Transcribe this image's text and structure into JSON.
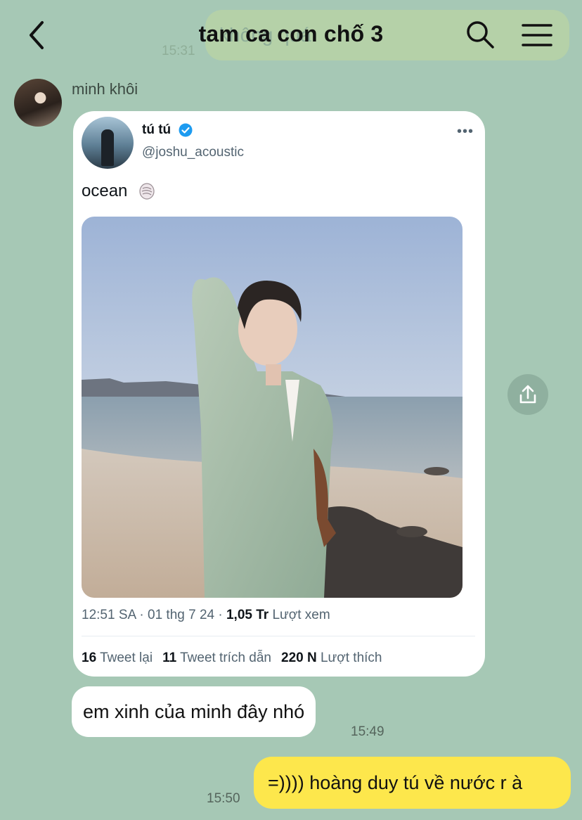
{
  "header": {
    "title": "tam ca con chố 3",
    "ghost_text": "không quá",
    "ghost_time": "15:31"
  },
  "sender": {
    "name": "minh khôi"
  },
  "tweet": {
    "display_name": "tú tú",
    "handle": "@joshu_acoustic",
    "text": "ocean",
    "more": "•••",
    "time": "12:51 SA · 01 thg 7 24 · ",
    "views_value": "1,05 Tr",
    "views_label": " Lượt xem",
    "retweets_value": "16",
    "retweets_label": " Tweet lại",
    "quotes_value": "11",
    "quotes_label": " Tweet trích dẫn",
    "likes_value": "220 N",
    "likes_label": " Lượt thích"
  },
  "messages": {
    "incoming_text": "em xinh của minh đây nhó",
    "incoming_time": "15:49",
    "outgoing_text": "=)))) hoàng duy tú về nước r à",
    "outgoing_time": "15:50"
  },
  "icons": {
    "back": "back-icon",
    "search": "search-icon",
    "menu": "menu-icon",
    "share": "share-icon",
    "verified": "verified-icon",
    "shell": "shell-emoji-icon"
  },
  "colors": {
    "background": "#a6c8b5",
    "outgoing_bubble": "#fde74c",
    "incoming_bubble": "#ffffff",
    "verified": "#1d9bf0"
  }
}
